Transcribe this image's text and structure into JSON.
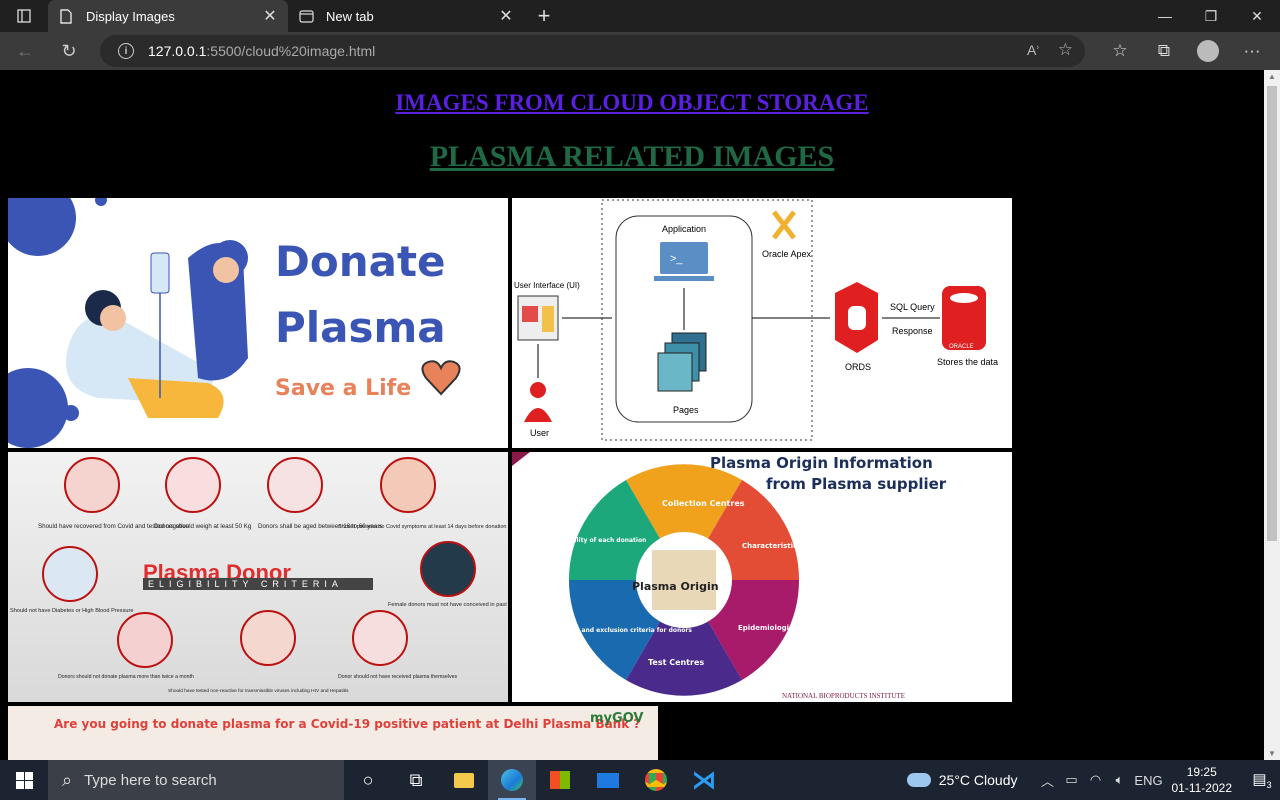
{
  "browser": {
    "tabs": [
      {
        "title": "Display Images",
        "active": true
      },
      {
        "title": "New tab",
        "active": false
      }
    ],
    "address": {
      "host": "127.0.0.1",
      "rest": ":5500/cloud%20image.html"
    }
  },
  "page": {
    "heading": "IMAGES FROM CLOUD OBJECT STORAGE",
    "subheading": "PLASMA RELATED IMAGES",
    "image1": {
      "line1": "Donate",
      "line2": "Plasma",
      "line3": "Save a Life"
    },
    "image2": {
      "user_ui": "User Interface (UI)",
      "user": "User",
      "application": "Application",
      "pages": "Pages",
      "apex": "Oracle Apex",
      "ords": "ORDS",
      "sql": "SQL Query",
      "response": "Response",
      "stores": "Stores the data",
      "oracle": "ORACLE"
    },
    "image3": {
      "title": "Plasma Donor",
      "subtitle": "ELIGIBILITY CRITERIA",
      "c1": "Should have recovered from Covid and tested negative",
      "c2": "Donors should weigh at least 50 Kg",
      "c3": "Donors shall be aged between 18 to 60 years",
      "c4": "Should possess no Covid symptoms at least 14 days before donation",
      "c5": "Should not have Diabetes or High Blood Pressure",
      "c6": "Female donors must not have conceived in past",
      "c7": "Donors should not donate plasma more than twice a month",
      "c8": "Should have tested non-reactive for transmissible viruses including HIV and Hepatitis",
      "c9": "Donor should not have received plasma themselves"
    },
    "image4": {
      "title1": "Plasma Origin Information",
      "title2": "from Plasma supplier",
      "center": "Plasma Origin",
      "s1": "Collection Centres",
      "s2": "Characteristics of donations",
      "s3": "Epidemiological Data",
      "s4": "Test Centres",
      "s5": "Selection and exclusion criteria for donors",
      "s6": "Traceability of each donation",
      "footer": "NATIONAL BIOPRODUCTS INSTITUTE"
    },
    "image5": {
      "text": "Are you going to donate plasma for a Covid-19 positive patient at Delhi Plasma Bank ?",
      "logo": "myGOV"
    }
  },
  "taskbar": {
    "search_placeholder": "Type here to search",
    "weather": "25°C  Cloudy",
    "lang": "ENG",
    "time": "19:25",
    "date": "01-11-2022",
    "notifications": "3"
  },
  "colors": {
    "heading": "#5a1fe0",
    "subheading": "#1f6a45",
    "donate_blue": "#3a55b4",
    "save_orange": "#e8825a"
  }
}
